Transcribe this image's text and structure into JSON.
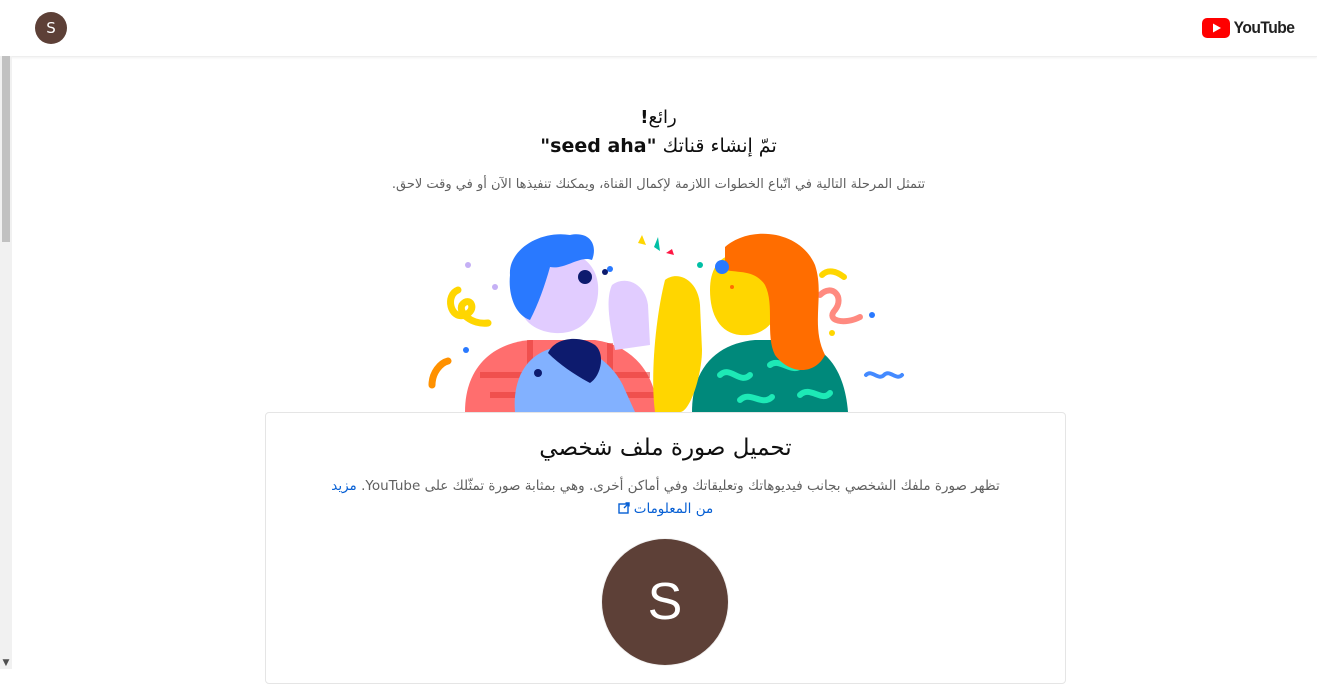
{
  "header": {
    "avatar_letter": "S",
    "logo_text": "YouTube",
    "brand_red": "#ff0000"
  },
  "intro": {
    "great": "رائع",
    "exclaim": "!",
    "created_prefix": "تمّ إنشاء قناتك ",
    "channel_name": "\"seed aha\"",
    "next_step": "تتمثل المرحلة التالية في اتّباع الخطوات اللازمة لإكمال القناة، ويمكنك تنفيذها الآن أو في وقت لاحق."
  },
  "profile_card": {
    "title": "تحميل صورة ملف شخصي",
    "description": "تظهر صورة ملفك الشخصي بجانب فيديوهاتك وتعليقاتك وفي أماكن أخرى. وهي بمثابة صورة تمثّلك على YouTube.",
    "learn_more": "مزيد من المعلومات",
    "avatar_letter": "S",
    "avatar_color": "#5d4037"
  }
}
